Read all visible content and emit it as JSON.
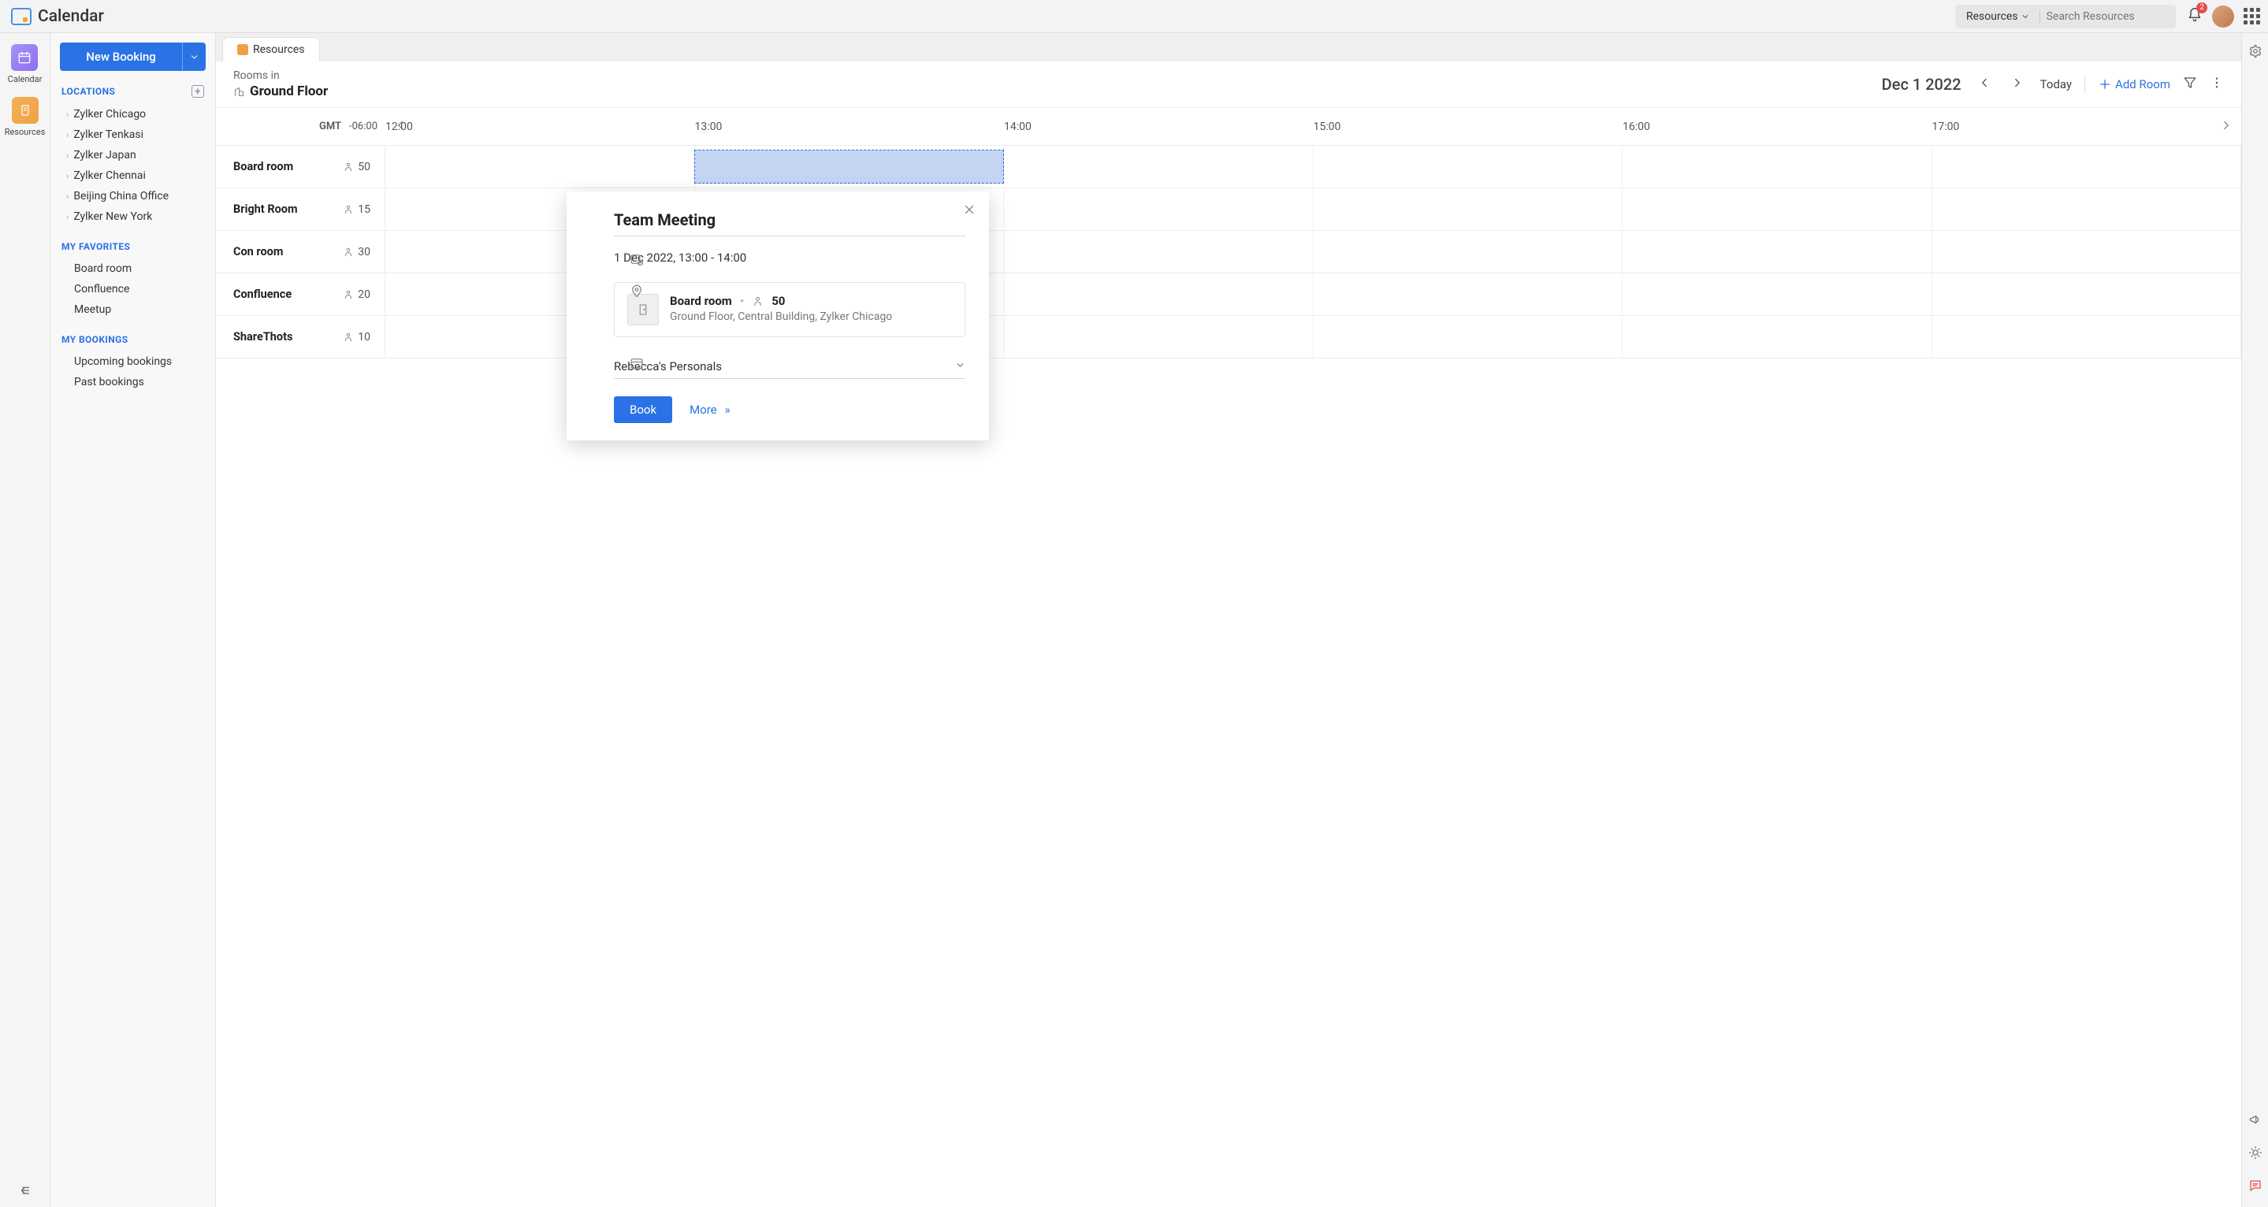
{
  "brand": "Calendar",
  "topbar": {
    "search_selector": "Resources",
    "search_placeholder": "Search Resources",
    "badge_count": "2"
  },
  "rail": {
    "calendar_label": "Calendar",
    "resources_label": "Resources"
  },
  "sidebar": {
    "new_booking": "New Booking",
    "locations_header": "LOCATIONS",
    "locations": [
      "Zylker Chicago",
      "Zylker Tenkasi",
      "Zylker Japan",
      "Zylker Chennai",
      "Beijing China Office",
      "Zylker New York"
    ],
    "favorites_header": "MY FAVORITES",
    "favorites": [
      "Board room",
      "Confluence",
      "Meetup"
    ],
    "bookings_header": "MY BOOKINGS",
    "bookings": [
      "Upcoming bookings",
      "Past bookings"
    ]
  },
  "tab": {
    "label": "Resources"
  },
  "toolbar": {
    "rooms_in": "Rooms in",
    "floor": "Ground Floor",
    "date": "Dec 1 2022",
    "today": "Today",
    "add_room": "Add Room"
  },
  "timeline": {
    "tz_label": "GMT",
    "tz_offset": "-06:00",
    "hours": [
      "12:00",
      "13:00",
      "14:00",
      "15:00",
      "16:00",
      "17:00"
    ],
    "rooms": [
      {
        "name": "Board room",
        "capacity": "50"
      },
      {
        "name": "Bright Room",
        "capacity": "15"
      },
      {
        "name": "Con room",
        "capacity": "30"
      },
      {
        "name": "Confluence",
        "capacity": "20"
      },
      {
        "name": "ShareThots",
        "capacity": "10"
      }
    ]
  },
  "popover": {
    "title": "Team Meeting",
    "datetime": "1 Dec 2022,  13:00 -  14:00",
    "room_name": "Board room",
    "room_capacity": "50",
    "room_location": "Ground Floor, Central Building, Zylker Chicago",
    "calendar_name": "Rebecca's Personals",
    "book": "Book",
    "more": "More"
  }
}
